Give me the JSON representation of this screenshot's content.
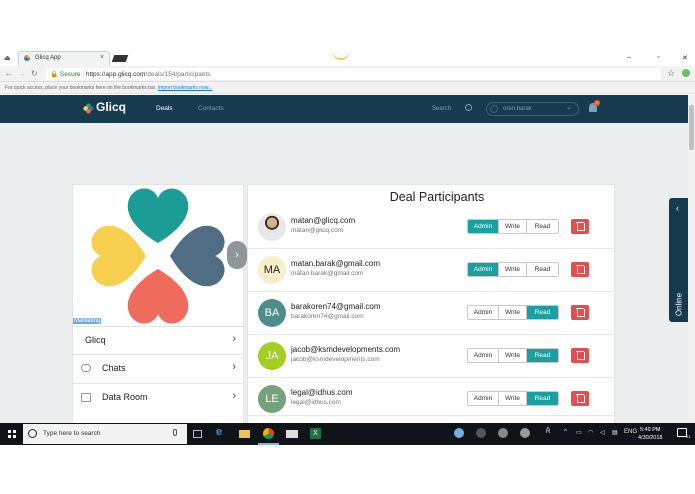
{
  "browser": {
    "tab_title": "Glicq App",
    "tab_close": "×",
    "secure_label": "Secure",
    "url_host": "https://app.glicq.com",
    "url_path": "/deals/154/participants",
    "bookmarks_text": "For quick access, place your bookmarks here on the bookmarks bar.",
    "bookmarks_link": "Import bookmarks now...",
    "window_minimize": "–",
    "window_maximize": "▫",
    "window_close": "✕",
    "star_icon": "☆"
  },
  "app_nav": {
    "brand": "Glicq",
    "deals": "Deals",
    "contacts": "Contacts",
    "search": "Search",
    "user": "oren.barak",
    "notifications_count": "1"
  },
  "left_panel": {
    "image_caption": "Marketing",
    "title_row": "Glicq",
    "items": [
      {
        "label": "Chats",
        "icon": "chat-bubble-icon"
      },
      {
        "label": "Data Room",
        "icon": "folder-icon"
      }
    ]
  },
  "participants": {
    "title": "Deal Participants",
    "role_labels": [
      "Admin",
      "Write",
      "Read"
    ],
    "rows": [
      {
        "initials": "",
        "name": "matan@glicq.com",
        "email": "matan@glicq.com",
        "avatar_color": "#3d4a55",
        "active_role": "Admin"
      },
      {
        "initials": "MA",
        "name": "matan.barak@gmail.com",
        "email": "matan.barak@gmail.com",
        "avatar_color": "#f7efc9",
        "active_role": "Admin"
      },
      {
        "initials": "BA",
        "name": "barakoren74@gmail.com",
        "email": "barakoren74@gmail.com",
        "avatar_color": "#4f8d8a",
        "active_role": "Read"
      },
      {
        "initials": "JA",
        "name": "jacob@ksmdevelopments.com",
        "email": "jacob@ksmdevelopments.com",
        "avatar_color": "#a6cd24",
        "active_role": "Read"
      },
      {
        "initials": "LE",
        "name": "legal@idhus.com",
        "email": "legal@idhus.com",
        "avatar_color": "#74a07b",
        "active_role": "Read"
      }
    ]
  },
  "online_tab": {
    "label": "Online",
    "chevron": "‹"
  },
  "taskbar": {
    "search_placeholder": "Type here to search",
    "language": "ENG",
    "time": "5:49 PM",
    "date": "4/30/2018",
    "notif_count": "21"
  },
  "colors": {
    "nav_bg": "#163a4e",
    "accent_teal": "#1aa0a0",
    "delete_red": "#e64d4d",
    "clover_teal": "#1b9c94",
    "clover_yellow": "#f6cf4e",
    "clover_blue": "#516d84",
    "clover_coral": "#ef6b5b"
  }
}
